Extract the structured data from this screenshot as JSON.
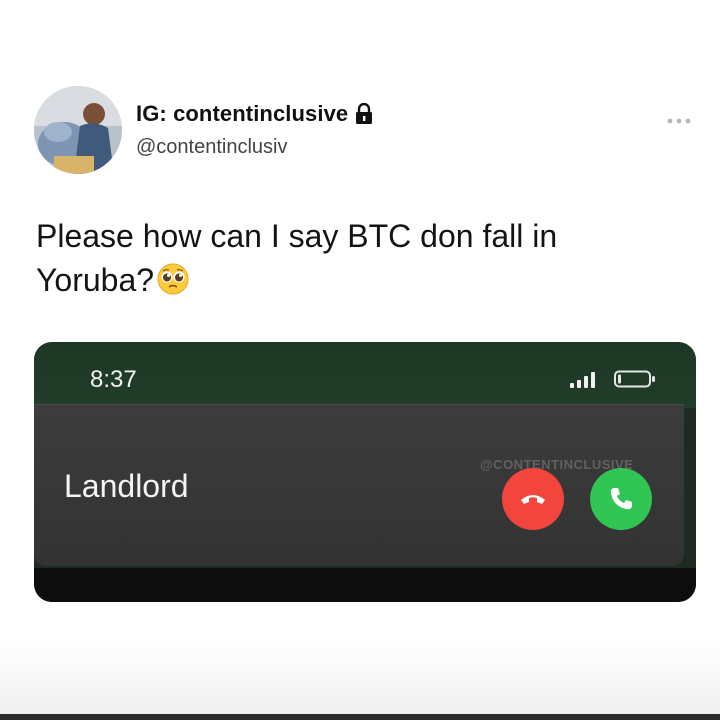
{
  "tweet": {
    "display_name": "IG: contentinclusive",
    "handle": "@contentinclusiv",
    "text": "Please how can I say BTC don fall in Yoruba?",
    "emoji": "pleading-face",
    "more_icon": "more-horizontal-icon",
    "lock_icon": "lock-icon"
  },
  "media": {
    "status_time": "8:37",
    "caller": "Landlord",
    "watermark": "@CONTENTINCLUSIVE",
    "decline_icon": "phone-decline-icon",
    "accept_icon": "phone-accept-icon",
    "colors": {
      "decline": "#f2453d",
      "accept": "#31c553",
      "banner": "#383838",
      "top": "#1f3a27"
    }
  }
}
